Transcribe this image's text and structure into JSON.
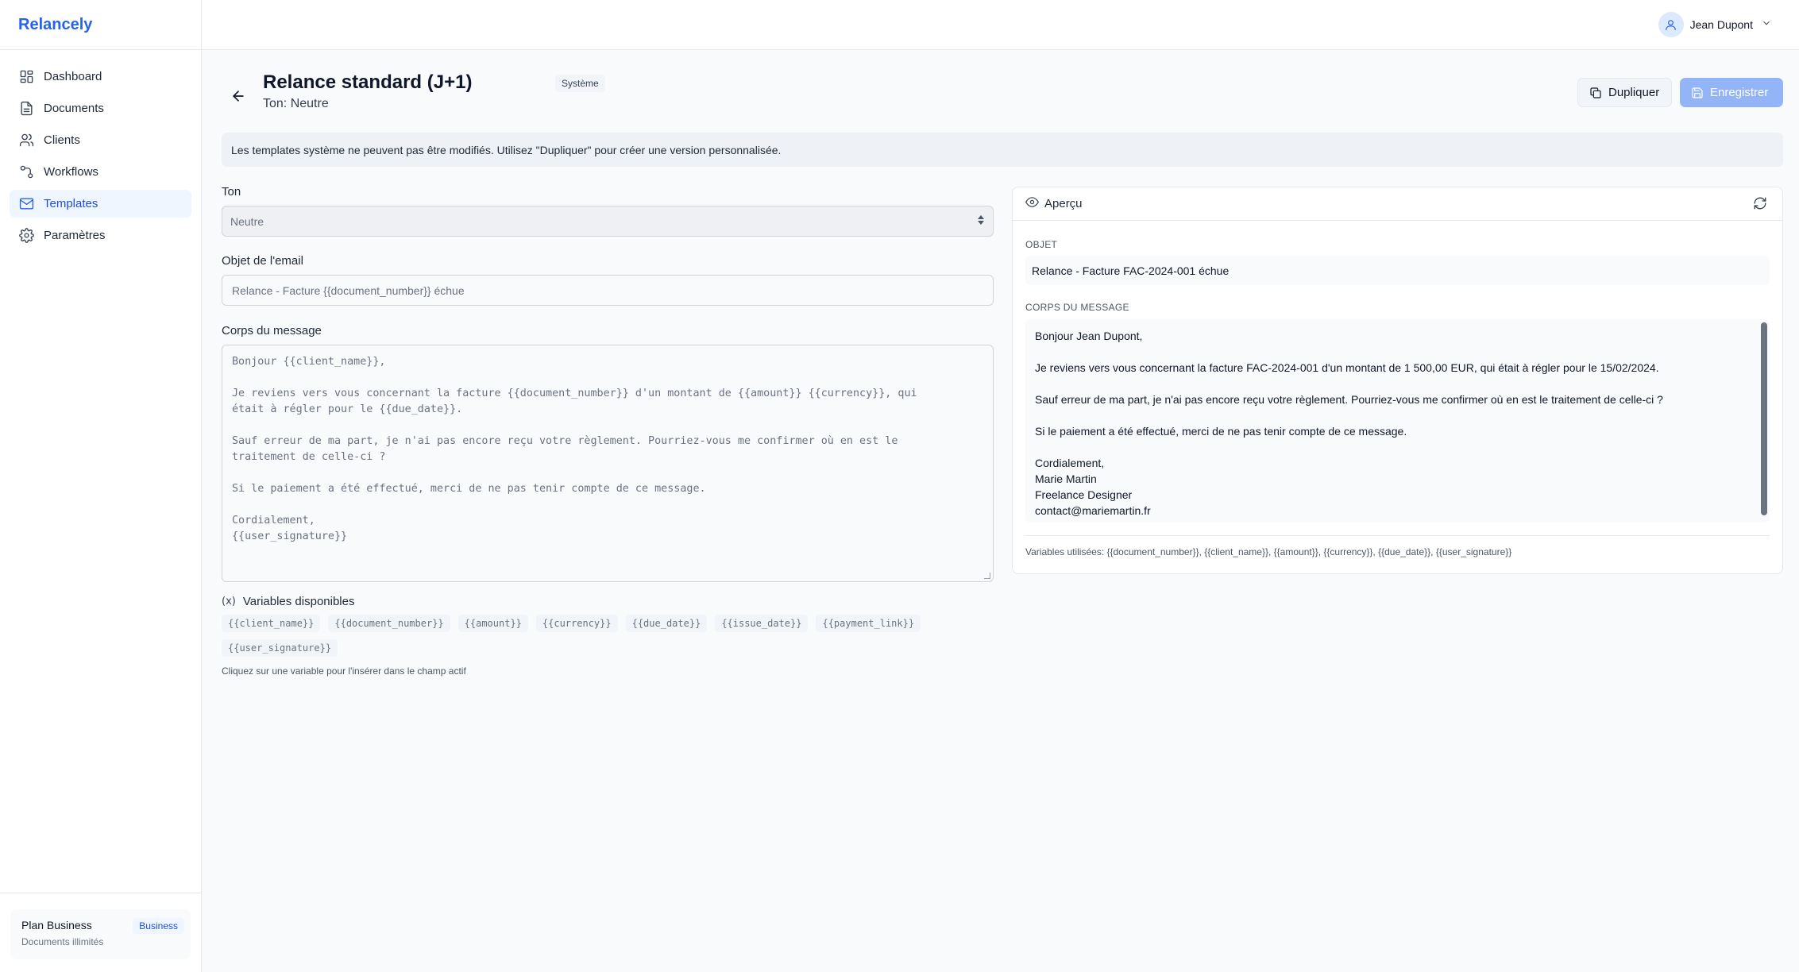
{
  "brand": "Relancely",
  "nav": [
    {
      "label": "Dashboard",
      "icon": "dashboard-icon"
    },
    {
      "label": "Documents",
      "icon": "document-icon"
    },
    {
      "label": "Clients",
      "icon": "users-icon"
    },
    {
      "label": "Workflows",
      "icon": "workflow-icon"
    },
    {
      "label": "Templates",
      "icon": "mail-icon"
    },
    {
      "label": "Paramètres",
      "icon": "gear-icon"
    }
  ],
  "active_nav": "Templates",
  "plan": {
    "name": "Plan Business",
    "badge": "Business",
    "sub": "Documents illimités"
  },
  "user": {
    "name": "Jean Dupont"
  },
  "header": {
    "title": "Relance standard (J+1)",
    "subtitle": "Ton: Neutre",
    "badge": "Système"
  },
  "buttons": {
    "duplicate": "Dupliquer",
    "save": "Enregistrer"
  },
  "notice": "Les templates système ne peuvent pas être modifiés. Utilisez \"Dupliquer\" pour créer une version personnalisée.",
  "form": {
    "tone_label": "Ton",
    "tone_value": "Neutre",
    "subject_label": "Objet de l'email",
    "subject_value": "Relance - Facture {{document_number}} échue",
    "body_label": "Corps du message",
    "body_value": "Bonjour {{client_name}},\n\nJe reviens vers vous concernant la facture {{document_number}} d'un montant de {{amount}} {{currency}}, qui\nétait à régler pour le {{due_date}}.\n\nSauf erreur de ma part, je n'ai pas encore reçu votre règlement. Pourriez-vous me confirmer où en est le\ntraitement de celle-ci ?\n\nSi le paiement a été effectué, merci de ne pas tenir compte de ce message.\n\nCordialement,\n{{user_signature}}"
  },
  "variables": {
    "icon_text": "(x)",
    "title": "Variables disponibles",
    "items": [
      "{{client_name}}",
      "{{document_number}}",
      "{{amount}}",
      "{{currency}}",
      "{{due_date}}",
      "{{issue_date}}",
      "{{payment_link}}",
      "{{user_signature}}"
    ],
    "hint": "Cliquez sur une variable pour l'insérer dans le champ actif"
  },
  "preview": {
    "title": "Aperçu",
    "subject_caption": "OBJET",
    "subject": "Relance - Facture FAC-2024-001 échue",
    "body_caption": "CORPS DU MESSAGE",
    "body": "Bonjour Jean Dupont,\n\nJe reviens vers vous concernant la facture FAC-2024-001 d'un montant de 1 500,00 EUR, qui était à régler pour le 15/02/2024.\n\nSauf erreur de ma part, je n'ai pas encore reçu votre règlement. Pourriez-vous me confirmer où en est le traitement de celle-ci ?\n\nSi le paiement a été effectué, merci de ne pas tenir compte de ce message.\n\nCordialement,\nMarie Martin\nFreelance Designer\ncontact@mariemartin.fr",
    "used_variables": "Variables utilisées: {{document_number}}, {{client_name}}, {{amount}}, {{currency}}, {{due_date}}, {{user_signature}}"
  },
  "colors": {
    "accent": "#2563eb",
    "active_bg": "#eff6ff",
    "save_disabled": "#93b4f6"
  }
}
